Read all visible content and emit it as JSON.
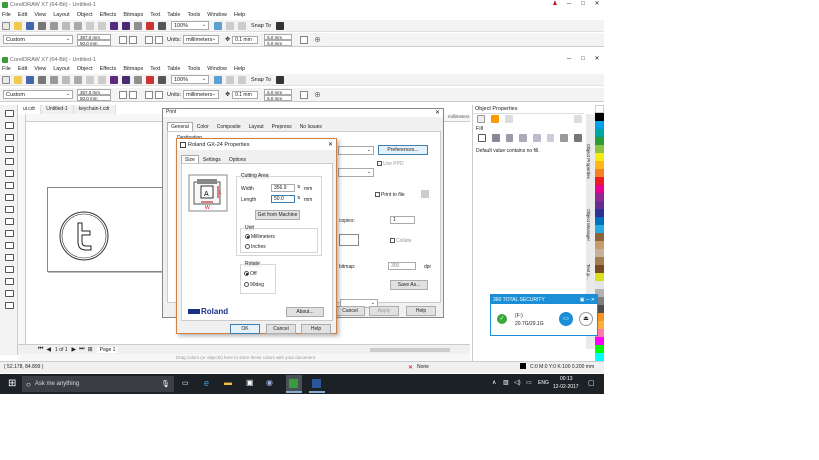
{
  "window1": {
    "title": "CorelDRAW X7 (64-Bit) - Untitled-1"
  },
  "window2": {
    "title": "CorelDRAW X7 (64-Bit) - Untitled-1"
  },
  "menu": [
    "File",
    "Edit",
    "View",
    "Layout",
    "Object",
    "Effects",
    "Bitmaps",
    "Text",
    "Table",
    "Tools",
    "Window",
    "Help"
  ],
  "toolbar": {
    "zoom": "100%",
    "snap_to": "Snap To"
  },
  "propbar": {
    "preset": "Custom",
    "width": "357.0 mm",
    "height": "50.0 mm",
    "units_label": "Units:",
    "units": "millimeters",
    "nudge": "0.1 mm",
    "dup_x": "5.0 mm",
    "dup_y": "5.0 mm"
  },
  "doctabs": [
    "ui.cdr",
    "Untitled-1",
    "keychain-t.cdr"
  ],
  "page_nav": {
    "of": "1 of 1",
    "page": "Page 1"
  },
  "statusbar": {
    "hint": "Drag colors (or objects) here to store these colors with your document",
    "coords": "( 52.178, 84.899 )",
    "fill": "None",
    "outline": "C:0 M:0 Y:0 K:100  0.200 mm"
  },
  "taskbar": {
    "search": "Ask me anything",
    "lang": "ENG",
    "time": "00:13",
    "date": "12-02-2017"
  },
  "docker": {
    "title": "Object Properties",
    "fill_label": "Fill",
    "fill_msg": "Default value contains no fill.",
    "side_tabs": [
      "Object Properties",
      "Object Manager",
      "Text p..."
    ]
  },
  "canvas_label": "millimeters",
  "print": {
    "title": "Print",
    "tabs": [
      "General",
      "Color",
      "Composite",
      "Layout",
      "Prepress",
      "No Issues"
    ],
    "destination": "Destination",
    "preferences": "Preferences...",
    "use_ppd": "Use PPD",
    "print_to_file": "Print to file",
    "copies_label": "copies:",
    "copies": "1",
    "collate": "Collate",
    "bitmap_label": "bitmap:",
    "bitmap_dpi": "300",
    "dpi": "dpi",
    "save_as": "Save As...",
    "cancel": "Cancel",
    "apply": "Apply",
    "help": "Help"
  },
  "roland": {
    "title": "Roland GX-24 Properties",
    "tabs": [
      "Size",
      "Settings",
      "Options"
    ],
    "cutting_area": "Cutting Area",
    "width_label": "Width",
    "width": "356.9",
    "length_label": "Length",
    "length": "50.0",
    "mm": "mm",
    "get_from_machine": "Get from Machine",
    "unit": "Unit",
    "millimeters": "Millimeters",
    "inches": "Inches",
    "rotate": "Rotate",
    "off": "Off",
    "deg90": "90deg",
    "about": "About...",
    "logo": "Roland",
    "ok": "OK",
    "cancel": "Cancel",
    "help": "Help"
  },
  "security": {
    "title": "360 TOTAL SECURITY",
    "drive": "(F:)",
    "size": "20.7G/29.1G"
  },
  "palette_colors": [
    "#ffffff",
    "#000000",
    "#00a0e8",
    "#00a7a0",
    "#2a9c3a",
    "#8bc53f",
    "#f5ea14",
    "#fcb816",
    "#f58220",
    "#ed1c24",
    "#e9008c",
    "#93278f",
    "#662d91",
    "#2e3192",
    "#0071bc",
    "#29abe2",
    "#8c6239",
    "#c69c6d",
    "#c7b299",
    "#a67c52",
    "#754c24",
    "#d9e021",
    "#e6e6e6",
    "#b3b3b3",
    "#808080",
    "#4d4d4d",
    "#f7931e",
    "#fbb03b",
    "#ff7bac",
    "#ff00ff",
    "#00ff00",
    "#00ffff"
  ]
}
